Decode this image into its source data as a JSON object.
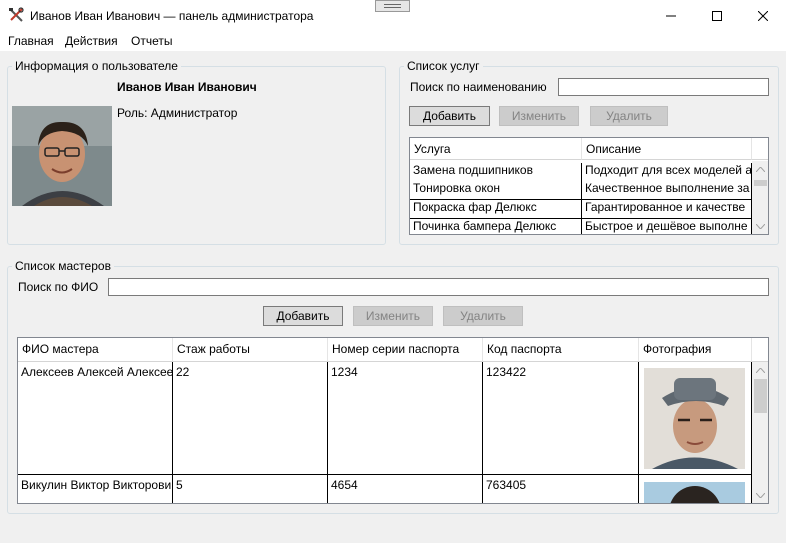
{
  "window": {
    "title": "Иванов Иван Иванович — панель администратора"
  },
  "menu": [
    "Главная",
    "Действия",
    "Отчеты"
  ],
  "user_info": {
    "legend": "Информация о пользователе",
    "full_name": "Иванов Иван Иванович",
    "role": "Роль: Администратор"
  },
  "services": {
    "legend": "Список услуг",
    "search_label": "Поиск по наименованию",
    "search_value": "",
    "buttons": {
      "add": "Добавить",
      "edit": "Изменить",
      "delete": "Удалить"
    },
    "columns": [
      "Услуга",
      "Описание"
    ],
    "rows": [
      [
        "Замена подшипников",
        "Подходит для всех моделей а"
      ],
      [
        "Тонировка окон",
        "Качественное выполнение за"
      ],
      [
        "Покраска фар Делюкс",
        "Гарантированное и качестве"
      ],
      [
        "Починка бампера Делюкс",
        "Быстрое и дешёвое выполне"
      ]
    ]
  },
  "masters": {
    "legend": "Список мастеров",
    "search_label": "Поиск по ФИО",
    "search_value": "",
    "buttons": {
      "add": "Добавить",
      "edit": "Изменить",
      "delete": "Удалить"
    },
    "columns": [
      "ФИО мастера",
      "Стаж работы",
      "Номер серии паспорта",
      "Код паспорта",
      "Фотография"
    ],
    "rows": [
      [
        "Алексеев Алексей Алексее",
        "22",
        "1234",
        "123422"
      ],
      [
        "Викулин Виктор Викторови",
        "5",
        "4654",
        "763405"
      ]
    ]
  },
  "colors": {
    "window_bg": "#f0f0f0",
    "group_border": "#d5dfe5",
    "grid_border": "#828790"
  }
}
